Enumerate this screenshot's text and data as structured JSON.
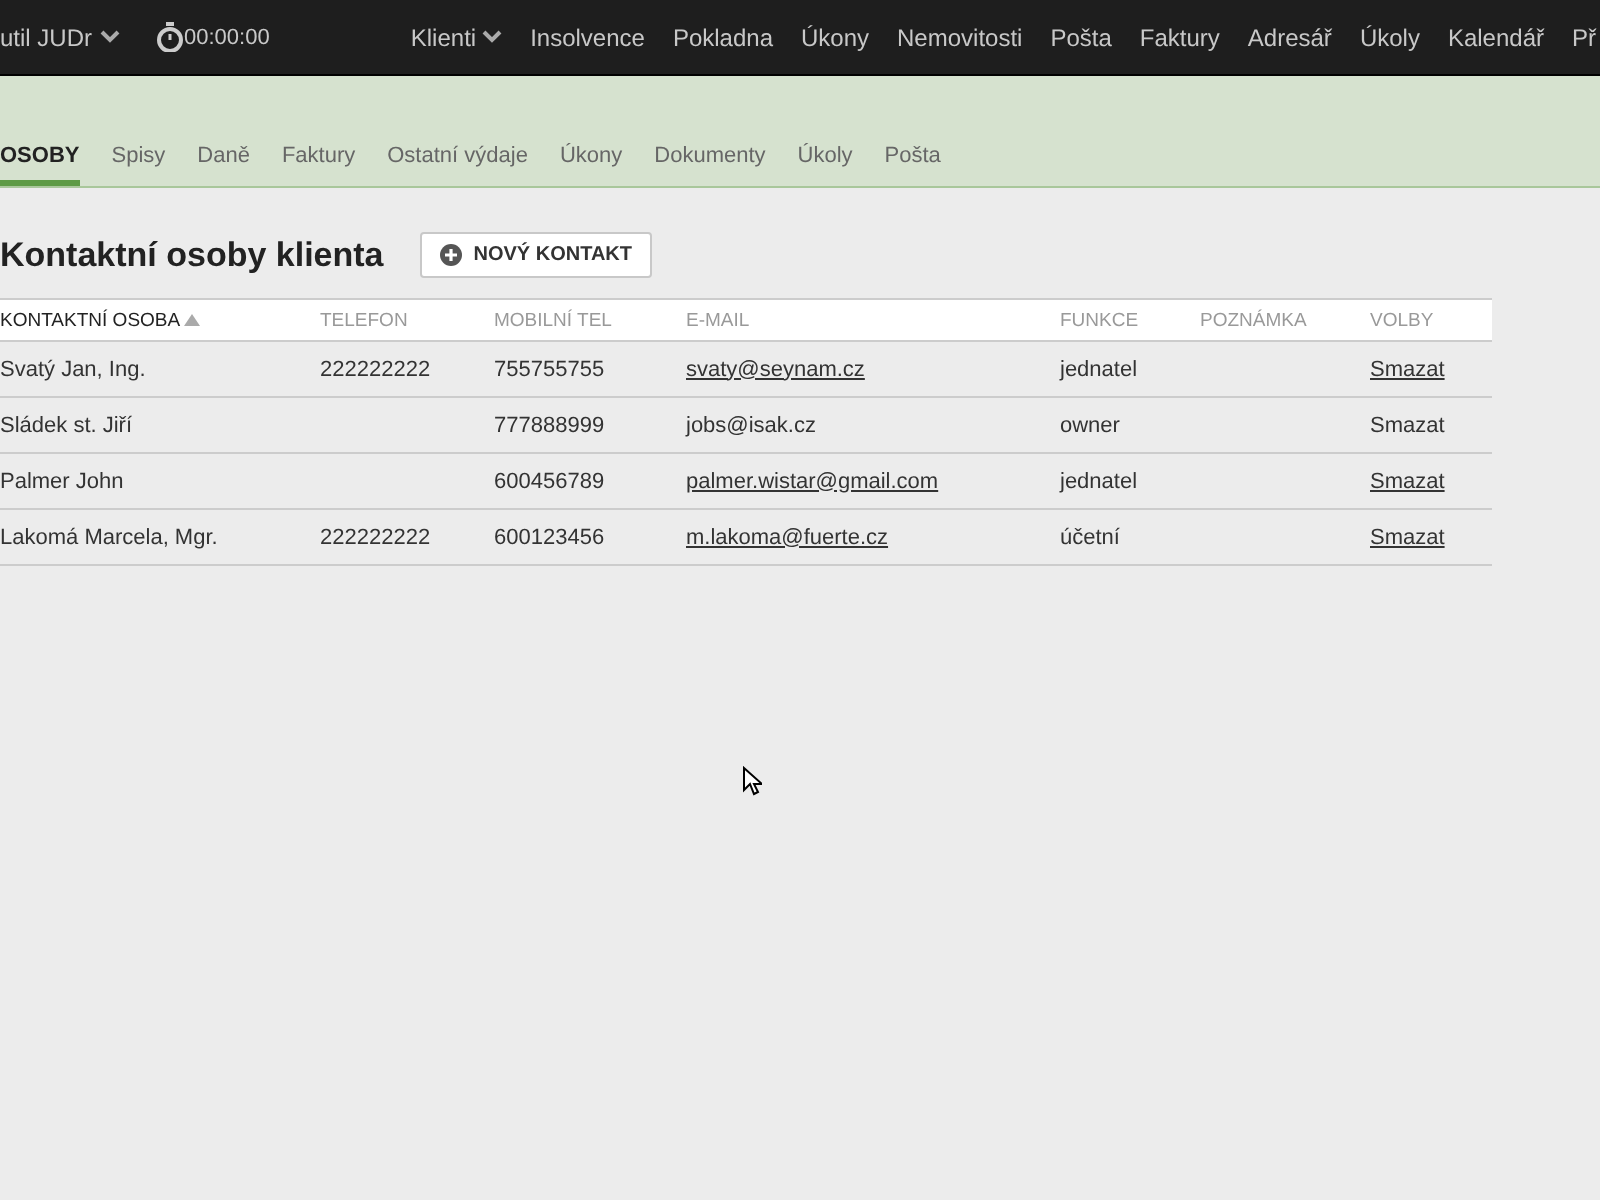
{
  "top_bar": {
    "user": "util JUDr",
    "timer": "00:00:00",
    "nav": [
      {
        "label": "Klienti",
        "dropdown": true
      },
      {
        "label": "Insolvence",
        "dropdown": false
      },
      {
        "label": "Pokladna",
        "dropdown": false
      },
      {
        "label": "Úkony",
        "dropdown": false
      },
      {
        "label": "Nemovitosti",
        "dropdown": false
      },
      {
        "label": "Pošta",
        "dropdown": false
      },
      {
        "label": "Faktury",
        "dropdown": false
      },
      {
        "label": "Adresář",
        "dropdown": false
      },
      {
        "label": "Úkoly",
        "dropdown": false
      },
      {
        "label": "Kalendář",
        "dropdown": false
      },
      {
        "label": "Př",
        "dropdown": false
      }
    ]
  },
  "tabs": [
    {
      "label": "OSOBY",
      "selected": true
    },
    {
      "label": "Spisy",
      "selected": false
    },
    {
      "label": "Daně",
      "selected": false
    },
    {
      "label": "Faktury",
      "selected": false
    },
    {
      "label": "Ostatní výdaje",
      "selected": false
    },
    {
      "label": "Úkony",
      "selected": false
    },
    {
      "label": "Dokumenty",
      "selected": false
    },
    {
      "label": "Úkoly",
      "selected": false
    },
    {
      "label": "Pošta",
      "selected": false
    }
  ],
  "heading": "Kontaktní osoby klienta",
  "new_button": "NOVÝ KONTAKT",
  "table": {
    "columns": [
      "KONTAKTNÍ OSOBA",
      "TELEFON",
      "MOBILNÍ TEL",
      "E-MAIL",
      "FUNKCE",
      "POZNÁMKA",
      "VOLBY"
    ],
    "rows": [
      {
        "name": "Svatý Jan, Ing.",
        "phone": "222222222",
        "mobile": "755755755",
        "email": "svaty@seynam.cz",
        "function": "jednatel",
        "action": "Smazat",
        "underlined": true
      },
      {
        "name": "Sládek st. Jiří",
        "mobile": "777888999",
        "email": "jobs@isak.cz",
        "function": "owner",
        "action": "Smazat",
        "underlined": false
      },
      {
        "name": "Palmer John",
        "mobile": "600456789",
        "email": "palmer.wistar@gmail.com",
        "function": "jednatel",
        "action": "Smazat",
        "underlined": true
      },
      {
        "name": "Lakomá Marcela, Mgr.",
        "phone": "222222222",
        "mobile": "600123456",
        "email": "m.lakoma@fuerte.cz",
        "function": "účetní",
        "action": "Smazat",
        "underlined": true
      }
    ]
  }
}
